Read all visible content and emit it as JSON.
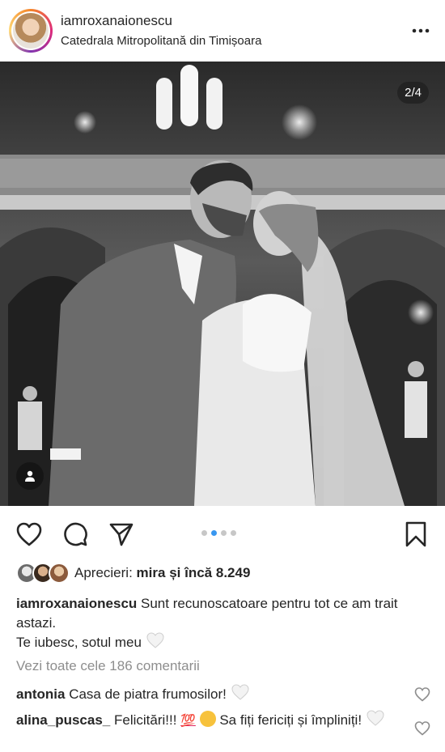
{
  "header": {
    "username": "iamroxanaionescu",
    "location": "Catedrala Mitropolitană din Timișoara"
  },
  "photo": {
    "counter": "2/4"
  },
  "carousel": {
    "total": 4,
    "active_index": 1
  },
  "likes": {
    "prefix": "Aprecieri:",
    "liker": "mira",
    "joiner": "și",
    "others": "încă 8.249"
  },
  "caption": {
    "username": "iamroxanaionescu",
    "text": "Sunt recunoscatoare pentru tot ce am trait astazi.",
    "line2": "Te iubesc, sotul meu"
  },
  "view_all_comments": "Vezi toate cele 186 comentarii",
  "comments": [
    {
      "username": "antonia",
      "text": "Casa de piatra frumosilor!"
    },
    {
      "username": "alina_puscas_",
      "text_a": "Felicitări!!!",
      "emoji_100": "💯",
      "text_b": "Sa fiți fericiți și împliniți!"
    }
  ],
  "colors": {
    "accent_blue": "#3897f0",
    "muted_gray": "#8e8e8e",
    "text": "#262626"
  },
  "icons": [
    "more-icon",
    "heart-icon",
    "comment-icon",
    "share-icon",
    "bookmark-icon",
    "user-tag-icon"
  ]
}
